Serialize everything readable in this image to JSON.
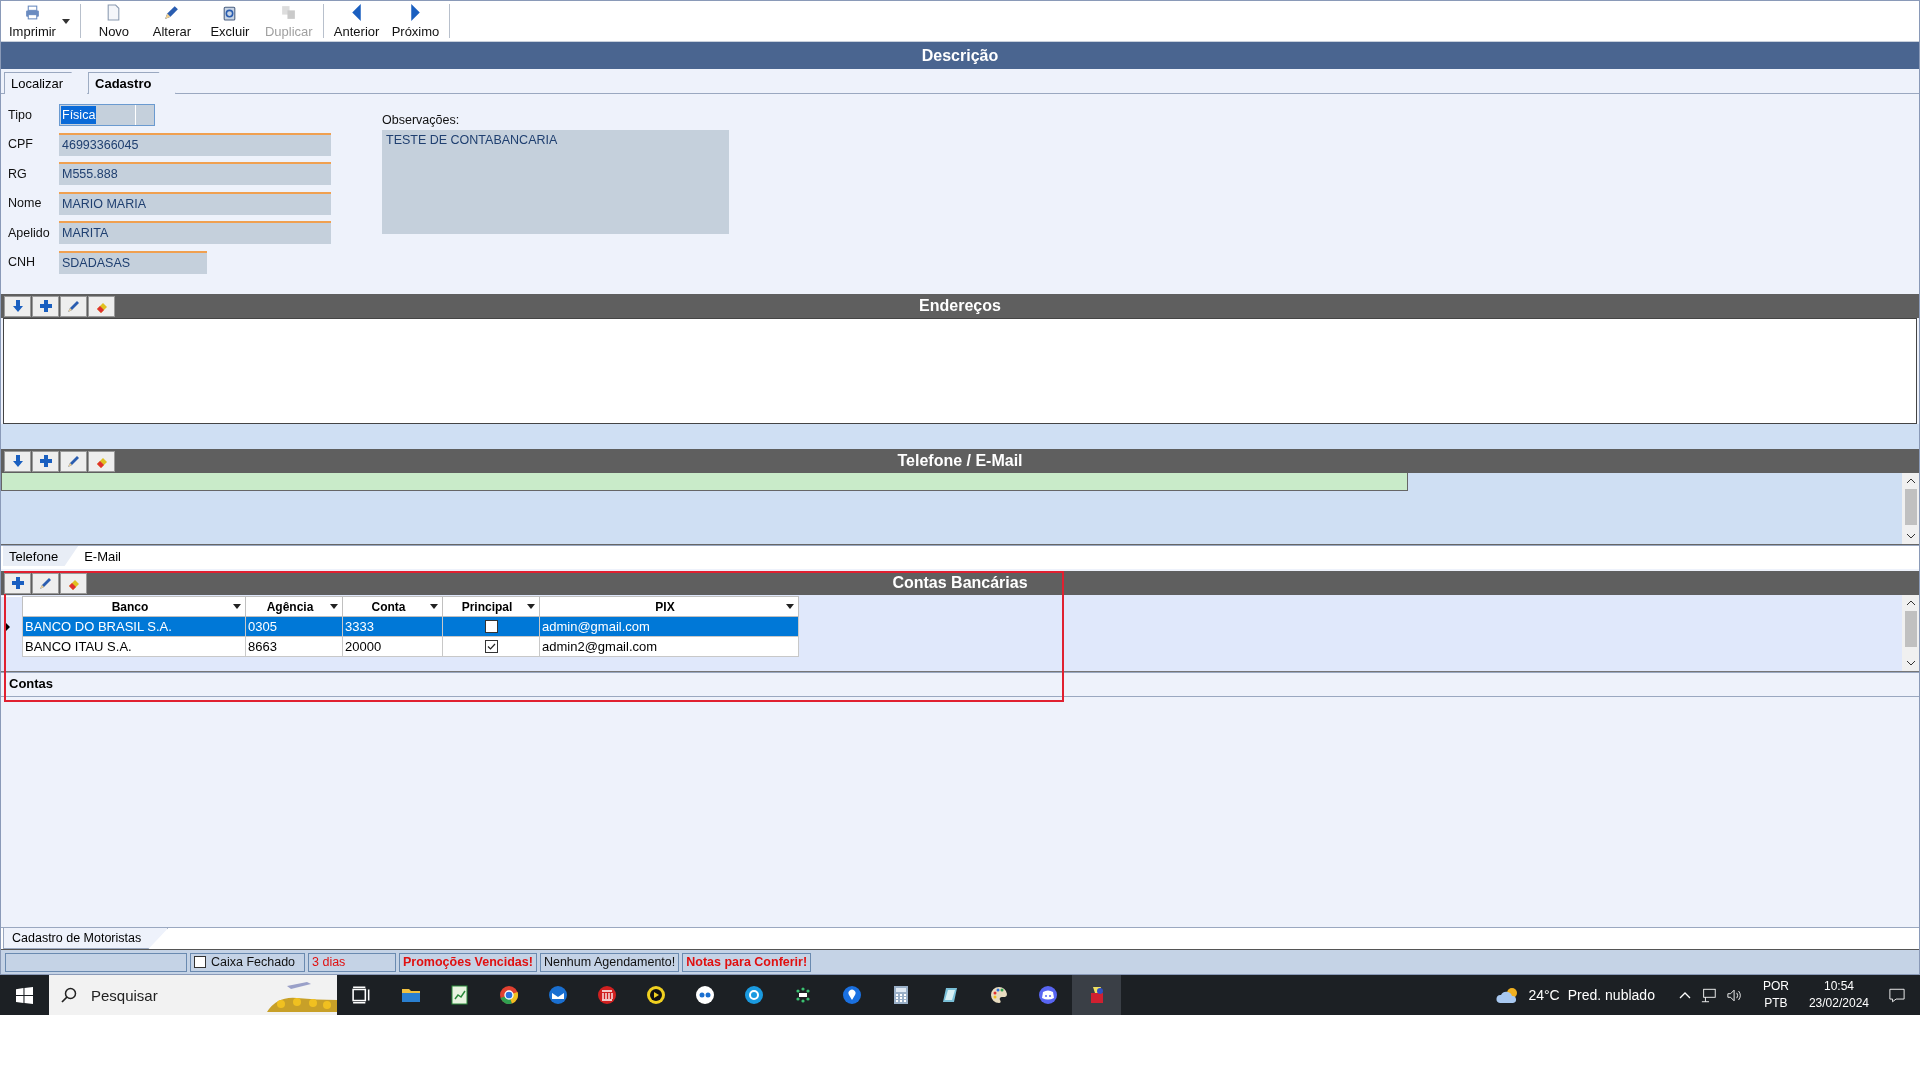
{
  "toolbar": {
    "buttons": [
      {
        "kind": "print",
        "label": "Imprimir",
        "disabled": false,
        "dropdown": true,
        "separator": true
      },
      {
        "kind": "new",
        "label": "Novo",
        "disabled": false,
        "dropdown": false,
        "separator": false
      },
      {
        "kind": "edit",
        "label": "Alterar",
        "disabled": false,
        "dropdown": false,
        "separator": false
      },
      {
        "kind": "delete",
        "label": "Excluir",
        "disabled": false,
        "dropdown": false,
        "separator": false
      },
      {
        "kind": "duplicate",
        "label": "Duplicar",
        "disabled": true,
        "dropdown": false,
        "separator": true
      },
      {
        "kind": "previous",
        "label": "Anterior",
        "disabled": false,
        "dropdown": false,
        "separator": false
      },
      {
        "kind": "next",
        "label": "Próximo",
        "disabled": false,
        "dropdown": false,
        "separator": true
      }
    ]
  },
  "header": {
    "title": "Descrição"
  },
  "tabs": [
    {
      "label": "Localizar",
      "selected": false
    },
    {
      "label": "Cadastro",
      "selected": true
    }
  ],
  "form": {
    "tipo": {
      "label": "Tipo",
      "value": "Física"
    },
    "fields": [
      {
        "label": "CPF",
        "value": "46993366045",
        "wide": true
      },
      {
        "label": "RG",
        "value": "M555.888",
        "wide": true
      },
      {
        "label": "Nome",
        "value": "MARIO MARIA",
        "wide": true
      },
      {
        "label": "Apelido",
        "value": "MARITA",
        "wide": true
      },
      {
        "label": "CNH",
        "value": "SDADASAS",
        "wide": false
      }
    ],
    "observacoes": {
      "label": "Observações:",
      "value": "TESTE DE CONTABANCARIA"
    }
  },
  "enderecos": {
    "title": "Endereços"
  },
  "telefone": {
    "title": "Telefone / E-Mail",
    "tabs": [
      {
        "label": "Telefone",
        "selected": true
      },
      {
        "label": "E-Mail",
        "selected": false
      }
    ]
  },
  "contas": {
    "title": "Contas Bancárias",
    "columns": [
      "Banco",
      "Agência",
      "Conta",
      "Principal",
      "PIX"
    ],
    "rows": [
      {
        "banco": "BANCO DO BRASIL S.A.",
        "agencia": "0305",
        "conta": "3333",
        "principal": false,
        "pix": "admin@gmail.com",
        "selected": true
      },
      {
        "banco": "BANCO ITAU S.A.",
        "agencia": "8663",
        "conta": "20000",
        "principal": true,
        "pix": "admin2@gmail.com",
        "selected": false
      }
    ],
    "tabs": [
      {
        "label": "Contas",
        "selected": true
      }
    ]
  },
  "bottom_tabs": [
    {
      "label": "Cadastro de Motoristas",
      "selected": true
    }
  ],
  "status_bar": [
    {
      "kind": "empty"
    },
    {
      "kind": "checkbox",
      "text": "Caixa Fechado",
      "checked": false
    },
    {
      "kind": "text",
      "text": "3 dias",
      "alert": true,
      "bold": false
    },
    {
      "kind": "text",
      "text": "Promoções Vencidas!",
      "alert": true,
      "bold": true
    },
    {
      "kind": "text",
      "text": "Nenhum Agendamento!",
      "alert": false,
      "bold": false
    },
    {
      "kind": "text",
      "text": "Notas para Conferir!",
      "alert": true,
      "bold": true
    }
  ],
  "taskbar": {
    "search": {
      "placeholder": "Pesquisar"
    },
    "apps": [
      {
        "kind": "folder",
        "selected": false
      },
      {
        "kind": "sheet",
        "selected": false
      },
      {
        "kind": "browser",
        "selected": false
      },
      {
        "kind": "mail",
        "selected": false
      },
      {
        "kind": "bank",
        "selected": false
      },
      {
        "kind": "arrow",
        "selected": false
      },
      {
        "kind": "dots",
        "selected": false
      },
      {
        "kind": "round",
        "selected": false
      },
      {
        "kind": "grid",
        "selected": false
      },
      {
        "kind": "pin",
        "selected": false
      },
      {
        "kind": "calculator",
        "selected": false
      },
      {
        "kind": "notebook",
        "selected": false
      },
      {
        "kind": "palette",
        "selected": false
      },
      {
        "kind": "chat",
        "selected": false
      },
      {
        "kind": "app",
        "selected": true
      }
    ],
    "weather": {
      "temperature": "24°C",
      "condition": "Pred. nublado"
    },
    "language": {
      "top": "POR",
      "bottom": "PTB"
    },
    "clock": {
      "time": "10:54",
      "date": "23/02/2024"
    }
  }
}
